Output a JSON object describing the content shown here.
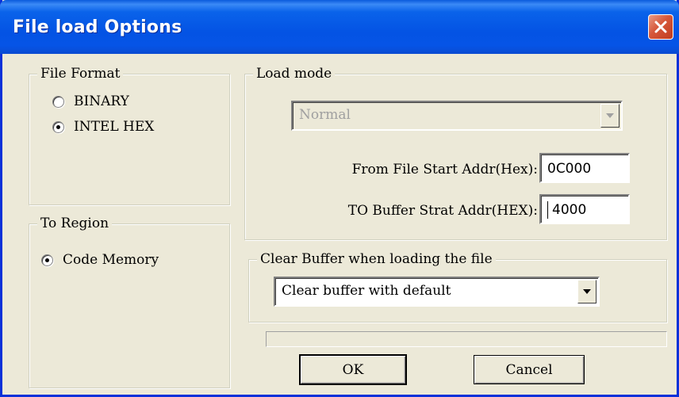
{
  "window": {
    "title": "File load Options"
  },
  "file_format": {
    "legend": "File Format",
    "options": [
      {
        "label": "BINARY",
        "checked": false
      },
      {
        "label": "INTEL HEX",
        "checked": true
      }
    ]
  },
  "to_region": {
    "legend": "To Region",
    "options": [
      {
        "label": "Code Memory",
        "checked": true
      }
    ]
  },
  "load_mode": {
    "legend": "Load mode",
    "mode_value": "Normal",
    "from_label": "From File Start Addr(Hex):",
    "from_value": "0C000",
    "to_label": "TO Buffer Strat Addr(HEX):",
    "to_value": "4000"
  },
  "clear_buffer": {
    "legend": "Clear Buffer when loading the file",
    "value": "Clear buffer with default"
  },
  "buttons": {
    "ok": "OK",
    "cancel": "Cancel"
  },
  "icons": {
    "close": "close-icon",
    "dropdown": "chevron-down-icon"
  },
  "colors": {
    "titlebar": "#0453e4",
    "close": "#c13c1e",
    "face": "#ece9d8"
  }
}
